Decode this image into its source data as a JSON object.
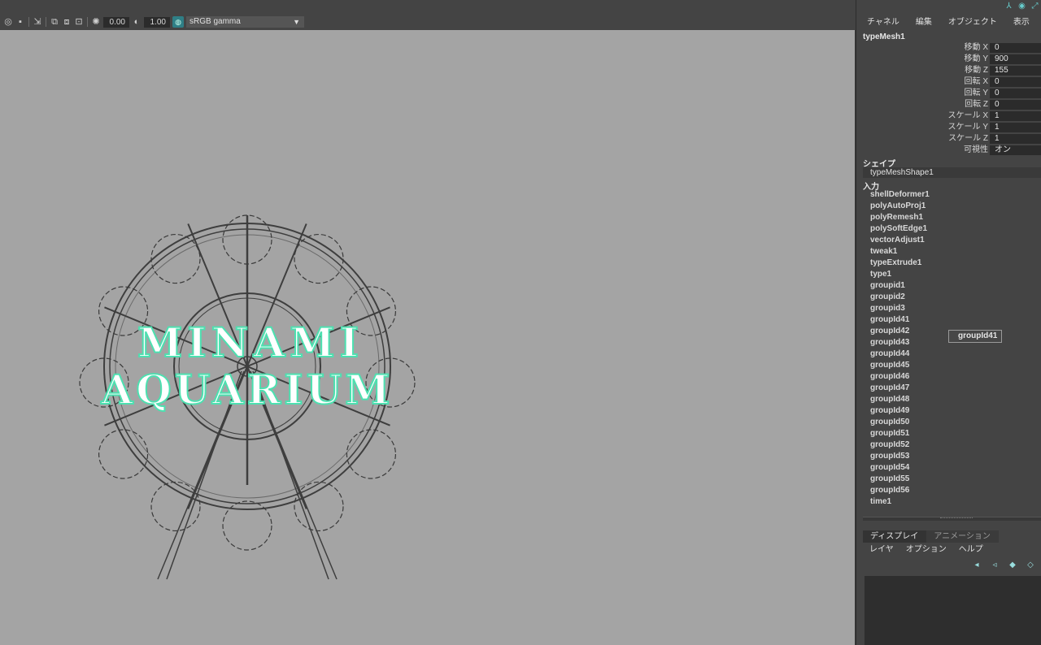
{
  "toolbar": {
    "exposure_value": "0.00",
    "gamma_value": "1.00",
    "color_space": "sRGB gamma"
  },
  "viewport": {
    "logo_line1": "MINAMI",
    "logo_line2": "AQUARIUM",
    "logo_color": "#4de0b0",
    "background_color": "#a4a4a4"
  },
  "channel_box": {
    "menu": [
      "チャネル",
      "編集",
      "オブジェクト",
      "表示"
    ],
    "object_name": "typeMesh1",
    "attributes": [
      {
        "label": "移動 X",
        "value": "0"
      },
      {
        "label": "移動 Y",
        "value": "900"
      },
      {
        "label": "移動 Z",
        "value": "155"
      },
      {
        "label": "回転 X",
        "value": "0"
      },
      {
        "label": "回転 Y",
        "value": "0"
      },
      {
        "label": "回転 Z",
        "value": "0"
      },
      {
        "label": "スケール X",
        "value": "1"
      },
      {
        "label": "スケール Y",
        "value": "1"
      },
      {
        "label": "スケール Z",
        "value": "1"
      },
      {
        "label": "可視性",
        "value": "オン"
      }
    ],
    "shape_heading": "シェイプ",
    "shape_name": "typeMeshShape1",
    "inputs_heading": "入力",
    "inputs": [
      "shellDeformer1",
      "polyAutoProj1",
      "polyRemesh1",
      "polySoftEdge1",
      "vectorAdjust1",
      "tweak1",
      "typeExtrude1",
      "type1",
      "groupid1",
      "groupid2",
      "groupid3",
      "groupId41",
      "groupId42",
      "groupId43",
      "groupId44",
      "groupId45",
      "groupId46",
      "groupId47",
      "groupId48",
      "groupId49",
      "groupId50",
      "groupId51",
      "groupId52",
      "groupId53",
      "groupId54",
      "groupId55",
      "groupId56",
      "time1"
    ],
    "tooltip": "groupId41"
  },
  "layer_editor": {
    "tabs": [
      "ディスプレイ",
      "アニメーション"
    ],
    "menu": [
      "レイヤ",
      "オプション",
      "ヘルプ"
    ]
  },
  "colors": {
    "panel_bg": "#444444",
    "field_bg": "#2b2b2b",
    "accent": "#2f7f86"
  }
}
